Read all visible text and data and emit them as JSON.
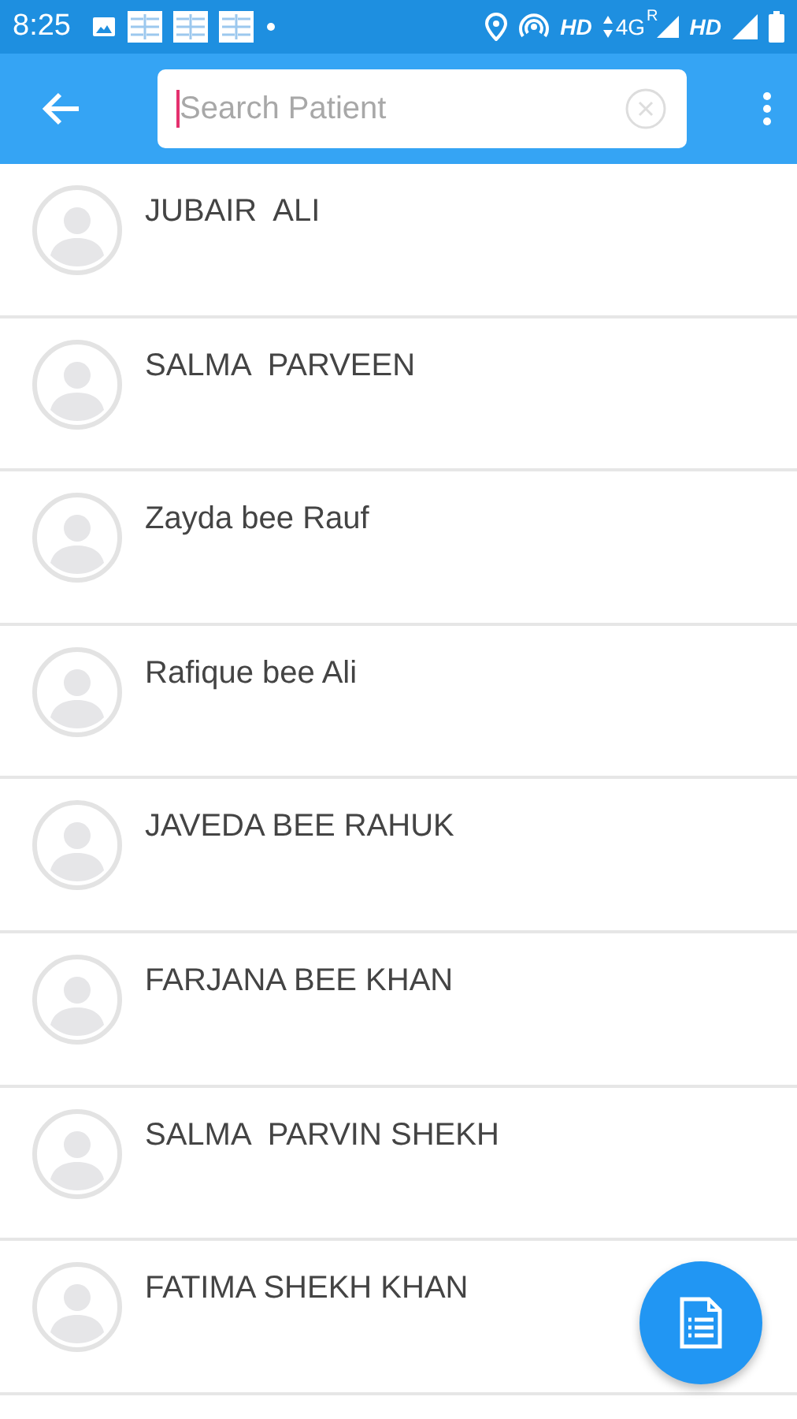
{
  "status_bar": {
    "time": "8:25",
    "network_1": "HD",
    "network_type": "4G",
    "roaming": "R",
    "network_2": "HD"
  },
  "toolbar": {
    "search": {
      "placeholder": "Search Patient"
    }
  },
  "patients": [
    {
      "name": "JUBAIR  ALI"
    },
    {
      "name": "SALMA  PARVEEN"
    },
    {
      "name": "Zayda bee Rauf"
    },
    {
      "name": "Rafique bee Ali"
    },
    {
      "name": "JAVEDA BEE RAHUK"
    },
    {
      "name": "FARJANA BEE KHAN"
    },
    {
      "name": "SALMA  PARVIN SHEKH"
    },
    {
      "name": "FATIMA SHEKH KHAN"
    }
  ]
}
